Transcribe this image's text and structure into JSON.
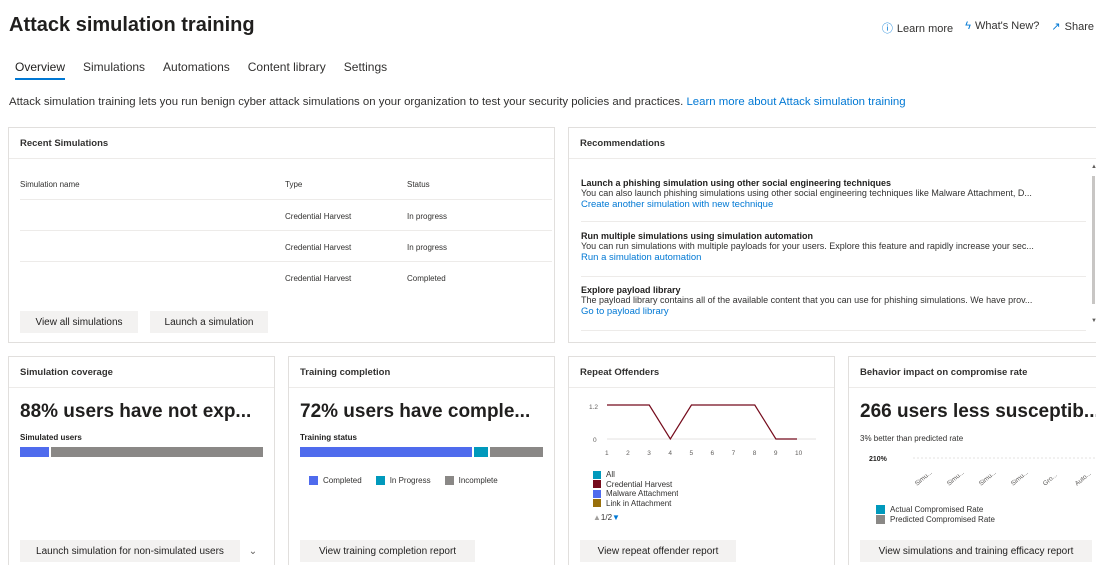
{
  "header": {
    "title": "Attack simulation training",
    "links": {
      "learn_more": "Learn more",
      "whats_new": "What's New?",
      "share": "Share"
    }
  },
  "tabs": [
    {
      "label": "Overview"
    },
    {
      "label": "Simulations"
    },
    {
      "label": "Automations"
    },
    {
      "label": "Content library"
    },
    {
      "label": "Settings"
    }
  ],
  "description": {
    "text": "Attack simulation training lets you run benign cyber attack simulations on your organization to test your security policies and practices.",
    "link": "Learn more about Attack simulation training"
  },
  "recent_simulations": {
    "title": "Recent Simulations",
    "columns": {
      "name": "Simulation name",
      "type": "Type",
      "status": "Status"
    },
    "rows": [
      {
        "type": "Credential Harvest",
        "status": "In progress"
      },
      {
        "type": "Credential Harvest",
        "status": "In progress"
      },
      {
        "type": "Credential Harvest",
        "status": "Completed"
      }
    ],
    "view_all_label": "View all simulations",
    "launch_label": "Launch a simulation"
  },
  "recommendations": {
    "title": "Recommendations",
    "items": [
      {
        "title": "Launch a phishing simulation using other social engineering techniques",
        "desc": "You can also launch phishing simulations using other social engineering techniques like Malware Attachment, D...",
        "link": "Create another simulation with new technique"
      },
      {
        "title": "Run multiple simulations using simulation automation",
        "desc": "You can run simulations with multiple payloads for your users. Explore this feature and rapidly increase your sec...",
        "link": "Run a simulation automation"
      },
      {
        "title": "Explore payload library",
        "desc": "The payload library contains all of the available content that you can use for phishing simulations. We have prov...",
        "link": "Go to payload library"
      }
    ]
  },
  "coverage": {
    "title": "Simulation coverage",
    "headline": "88% users have not exp...",
    "label": "Simulated users",
    "simulated_fraction": 0.12,
    "button": "Launch simulation for non-simulated users"
  },
  "training": {
    "title": "Training completion",
    "headline": "72% users have comple...",
    "label": "Training status",
    "completed_fraction": 0.72,
    "in_progress_fraction": 0.06,
    "legend": {
      "completed": "Completed",
      "in_progress": "In Progress",
      "incomplete": "Incomplete"
    },
    "button": "View training completion report"
  },
  "repeat": {
    "title": "Repeat Offenders",
    "y_ticks": [
      "1.2",
      "0"
    ],
    "x_ticks": [
      "1",
      "2",
      "3",
      "4",
      "5",
      "6",
      "7",
      "8",
      "9",
      "10"
    ],
    "legend": [
      "All",
      "Credential Harvest",
      "Malware Attachment",
      "Link in Attachment"
    ],
    "pager": "1/2",
    "button": "View repeat offender report"
  },
  "behavior": {
    "title": "Behavior impact on compromise rate",
    "headline": "266 users less susceptib...",
    "sub": "3% better than predicted rate",
    "y_tick": "210%",
    "x_labels": [
      "Simu...",
      "Simu...",
      "Simu...",
      "Simu...",
      "Gro...",
      "Auto..."
    ],
    "legend": {
      "actual": "Actual Compromised Rate",
      "predicted": "Predicted Compromised Rate"
    },
    "button": "View simulations and training efficacy report"
  },
  "chart_data": {
    "type": "line",
    "x": [
      1,
      2,
      3,
      4,
      5,
      6,
      7,
      8,
      9,
      10
    ],
    "series": [
      {
        "name": "Credential Harvest",
        "values": [
          1.2,
          1.2,
          1.2,
          0,
          1.2,
          1.2,
          1.2,
          1.2,
          0,
          0
        ]
      }
    ],
    "ylim": [
      0,
      1.2
    ]
  },
  "colors": {
    "accent": "#0078d4",
    "simulated": "#4f6bed",
    "not_simulated": "#8a8886",
    "completed": "#4f6bed",
    "in_progress": "#0099bc",
    "incomplete": "#8a8886",
    "all": "#0099bc",
    "credential": "#750b1c",
    "malware": "#4f6bed",
    "link": "#986f0b"
  }
}
